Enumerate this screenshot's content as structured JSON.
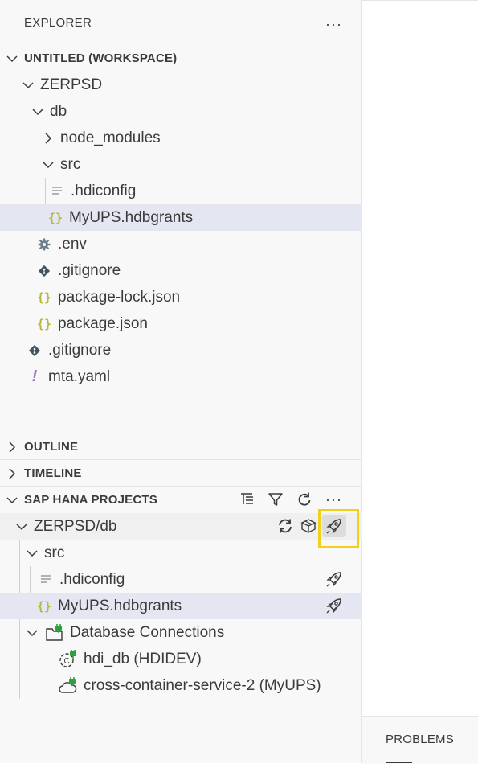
{
  "explorer": {
    "title": "EXPLORER",
    "more": "···",
    "workspace": "UNTITLED (WORKSPACE)",
    "tree": [
      {
        "label": "ZERPSD"
      },
      {
        "label": "db"
      },
      {
        "label": "node_modules"
      },
      {
        "label": "src"
      },
      {
        "label": ".hdiconfig"
      },
      {
        "label": "MyUPS.hdbgrants"
      },
      {
        "label": ".env"
      },
      {
        "label": ".gitignore"
      },
      {
        "label": "package-lock.json"
      },
      {
        "label": "package.json"
      },
      {
        "label": ".gitignore"
      },
      {
        "label": "mta.yaml"
      }
    ]
  },
  "sections": {
    "outline": "OUTLINE",
    "timeline": "TIMELINE",
    "hana": "SAP HANA PROJECTS"
  },
  "hana": {
    "more": "···",
    "tree": [
      {
        "label": "ZERPSD/db"
      },
      {
        "label": "src"
      },
      {
        "label": ".hdiconfig"
      },
      {
        "label": "MyUPS.hdbgrants"
      },
      {
        "label": "Database Connections"
      },
      {
        "label": "hdi_db (HDIDEV)"
      },
      {
        "label": "cross-container-service-2 (MyUPS)"
      }
    ]
  },
  "panel": {
    "problems": "PROBLEMS"
  },
  "colors": {
    "selection": "#e4e6f1",
    "highlight": "#f5cd1b",
    "json_icon": "#b7b73b",
    "yaml_icon": "#a074c4",
    "plug_green": "#2ea043"
  }
}
